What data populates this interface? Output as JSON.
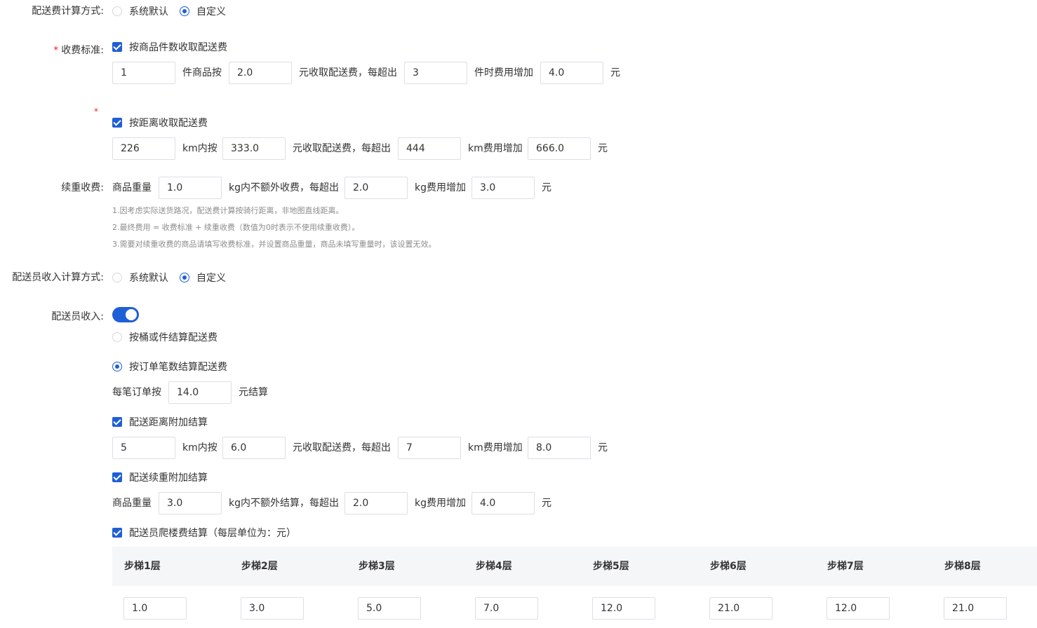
{
  "fee_method": {
    "label": "配送费计算方式:",
    "options": [
      "系统默认",
      "自定义"
    ],
    "selected": "自定义"
  },
  "charge_standard": {
    "label": "收费标准:",
    "by_count": {
      "label": "按商品件数收取配送费",
      "checked": true,
      "v1": "1",
      "t1": "件商品按",
      "v2": "2.0",
      "t2": "元收取配送费，每超出",
      "v3": "3",
      "t3": "件时费用增加",
      "v4": "4.0",
      "t4": "元"
    },
    "by_distance": {
      "label": "按距离收取配送费",
      "checked": true,
      "v1": "226",
      "t1": "km内按",
      "v2": "333.0",
      "t2": "元收取配送费，每超出",
      "v3": "444",
      "t3": "km费用增加",
      "v4": "666.0",
      "t4": "元"
    }
  },
  "extra_weight": {
    "label": "续重收费:",
    "t0": "商品重量",
    "v1": "1.0",
    "t1": "kg内不额外收费，每超出",
    "v2": "2.0",
    "t2": "kg费用增加",
    "v3": "3.0",
    "t3": "元"
  },
  "notes": [
    "1.因考虑实际送货路况，配送费计算按骑行距离，非地图直线距离。",
    "2.最终费用 = 收费标准 + 续重收费（数值为0时表示不使用续重收费）。",
    "3.需要对续重收费的商品请填写收费标准，并设置商品重量，商品未填写重量时，该设置无效。"
  ],
  "courier_method": {
    "label": "配送员收入计算方式:",
    "options": [
      "系统默认",
      "自定义"
    ],
    "selected": "自定义"
  },
  "courier_income": {
    "label": "配送员收入:",
    "enabled": true,
    "option_bucket": "按桶或件结算配送费",
    "option_order": "按订单笔数结算配送费",
    "selected": "按订单笔数结算配送费",
    "per_order": {
      "t0": "每笔订单按",
      "v1": "14.0",
      "t1": "元结算"
    },
    "distance": {
      "label": "配送距离附加结算",
      "checked": true,
      "v1": "5",
      "t1": "km内按",
      "v2": "6.0",
      "t2": "元收取配送费，每超出",
      "v3": "7",
      "t3": "km费用增加",
      "v4": "8.0",
      "t4": "元"
    },
    "weight": {
      "label": "配送续重附加结算",
      "checked": true,
      "t0": "商品重量",
      "v1": "3.0",
      "t1": "kg内不额外结算，每超出",
      "v2": "2.0",
      "t2": "kg费用增加",
      "v3": "4.0",
      "t3": "元"
    },
    "stairs": {
      "label": "配送员爬楼费结算（每层单位为：元）",
      "checked": true,
      "headers": [
        "步梯1层",
        "步梯2层",
        "步梯3层",
        "步梯4层",
        "步梯5层",
        "步梯6层",
        "步梯7层",
        "步梯8层"
      ],
      "values": [
        "1.0",
        "3.0",
        "5.0",
        "7.0",
        "12.0",
        "21.0",
        "12.0",
        "21.0"
      ]
    }
  }
}
